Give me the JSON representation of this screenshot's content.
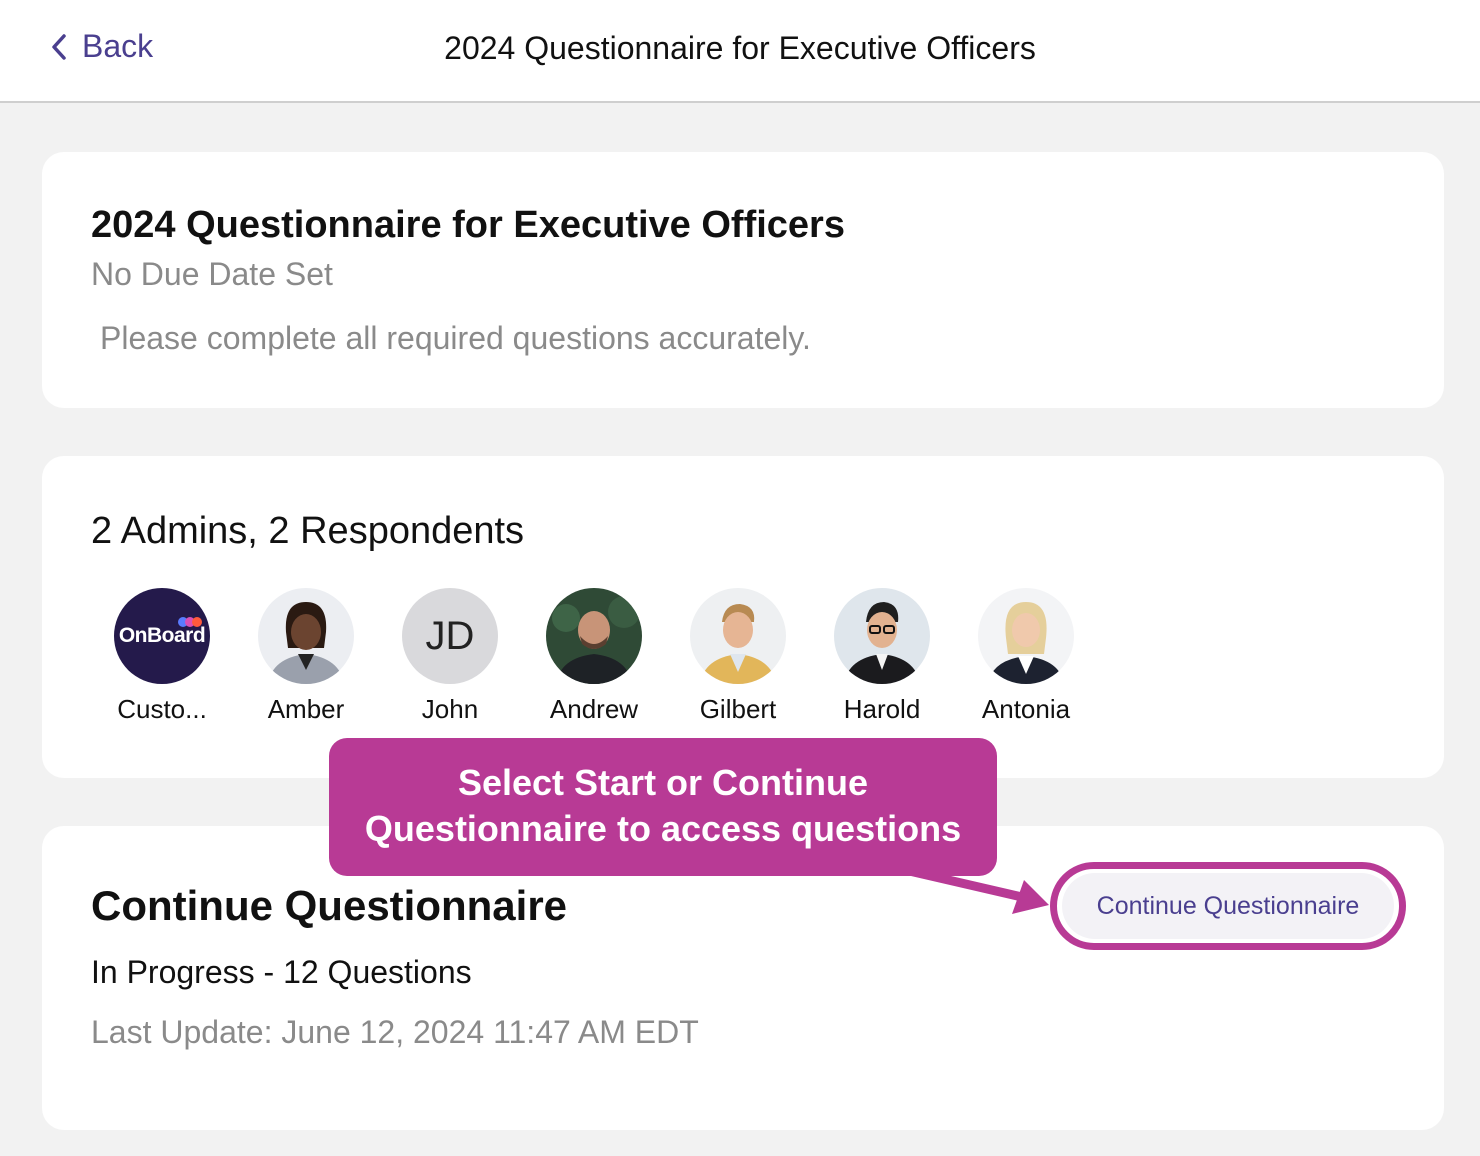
{
  "header": {
    "back_label": "Back",
    "title": "2024 Questionnaire for Executive Officers"
  },
  "summary": {
    "title": "2024 Questionnaire for Executive Officers",
    "due": "No Due Date Set",
    "description": "Please complete all required questions accurately."
  },
  "participants": {
    "heading": "2 Admins, 2 Respondents",
    "people": [
      {
        "name": "Custo...",
        "avatar_text": "OnBoard"
      },
      {
        "name": "Amber"
      },
      {
        "name": "John",
        "initials": "JD"
      },
      {
        "name": "Andrew"
      },
      {
        "name": "Gilbert"
      },
      {
        "name": "Harold"
      },
      {
        "name": "Antonia"
      }
    ]
  },
  "progress": {
    "title": "Continue Questionnaire",
    "status": "In Progress - 12 Questions",
    "last_update": "Last Update: June 12, 2024 11:47 AM EDT",
    "button_label": "Continue Questionnaire"
  },
  "callout": {
    "line1": "Select Start or Continue",
    "line2": "Questionnaire to access questions"
  },
  "colors": {
    "accent": "#4a3f8f",
    "highlight": "#b83a95",
    "onboard_bg": "#241a4b"
  }
}
